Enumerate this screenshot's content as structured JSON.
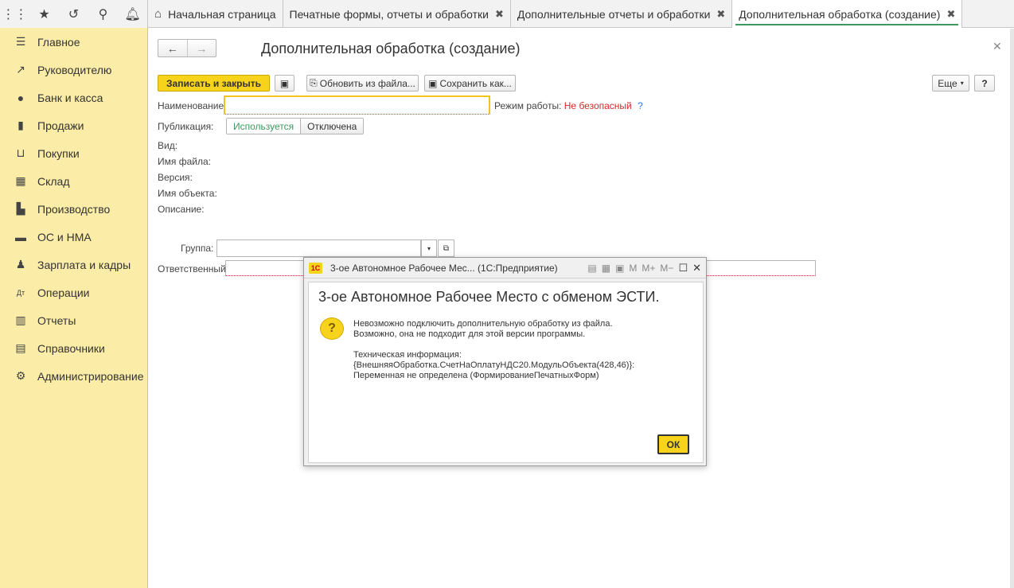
{
  "tabs": [
    {
      "label": "Начальная страница"
    },
    {
      "label": "Печатные формы, отчеты и обработки"
    },
    {
      "label": "Дополнительные отчеты и обработки"
    },
    {
      "label": "Дополнительная обработка (создание)"
    }
  ],
  "sidebar": {
    "items": [
      {
        "label": "Главное",
        "icon": "menu-lines-icon"
      },
      {
        "label": "Руководителю",
        "icon": "trend-icon"
      },
      {
        "label": "Банк и касса",
        "icon": "coin-icon"
      },
      {
        "label": "Продажи",
        "icon": "shopping-bag-icon"
      },
      {
        "label": "Покупки",
        "icon": "cart-icon"
      },
      {
        "label": "Склад",
        "icon": "warehouse-icon"
      },
      {
        "label": "Производство",
        "icon": "factory-icon"
      },
      {
        "label": "ОС и НМА",
        "icon": "truck-icon"
      },
      {
        "label": "Зарплата и кадры",
        "icon": "person-icon"
      },
      {
        "label": "Операции",
        "icon": "dt-kt-icon"
      },
      {
        "label": "Отчеты",
        "icon": "bar-chart-icon"
      },
      {
        "label": "Справочники",
        "icon": "books-icon"
      },
      {
        "label": "Администрирование",
        "icon": "gear-icon"
      }
    ]
  },
  "form": {
    "title": "Дополнительная обработка (создание)",
    "toolbar": {
      "save_close": "Записать и закрыть",
      "update_from_file": "Обновить из файла...",
      "save_as": "Сохранить как...",
      "more": "Еще",
      "help": "?"
    },
    "fields": {
      "name_label": "Наименование:",
      "mode_label": "Режим работы:",
      "mode_value": "Не безопасный",
      "mode_help": "?",
      "publication_label": "Публикация:",
      "publication_on": "Используется",
      "publication_off": "Отключена",
      "kind_label": "Вид:",
      "filename_label": "Имя файла:",
      "version_label": "Версия:",
      "object_name_label": "Имя объекта:",
      "description_label": "Описание:",
      "group_label": "Группа:",
      "responsible_label": "Ответственный:"
    }
  },
  "dialog": {
    "window_title": "3-ое Автономное Рабочее Мес...  (1С:Предприятие)",
    "logo_text": "1С",
    "tools": {
      "m": "M",
      "m_plus": "M+",
      "m_minus": "M−"
    },
    "heading": "3-ое Автономное Рабочее Место с обменом ЭСТИ.",
    "message_line1": "Невозможно подключить дополнительную обработку из файла.",
    "message_line2": "Возможно, она не подходит для этой версии программы.",
    "tech_label": "Техническая информация:",
    "tech_line1": "{ВнешняяОбработка.СчетНаОплатуНДС20.МодульОбъекта(428,46)}:",
    "tech_line2": "Переменная не определена (ФормированиеПечатныхФорм)",
    "ok": "ОК"
  },
  "colors": {
    "sidebar_bg": "#fbeca7",
    "accent_yellow": "#f7d31c",
    "active_tab": "#3c9a5f",
    "warning_red": "#d9262a"
  }
}
